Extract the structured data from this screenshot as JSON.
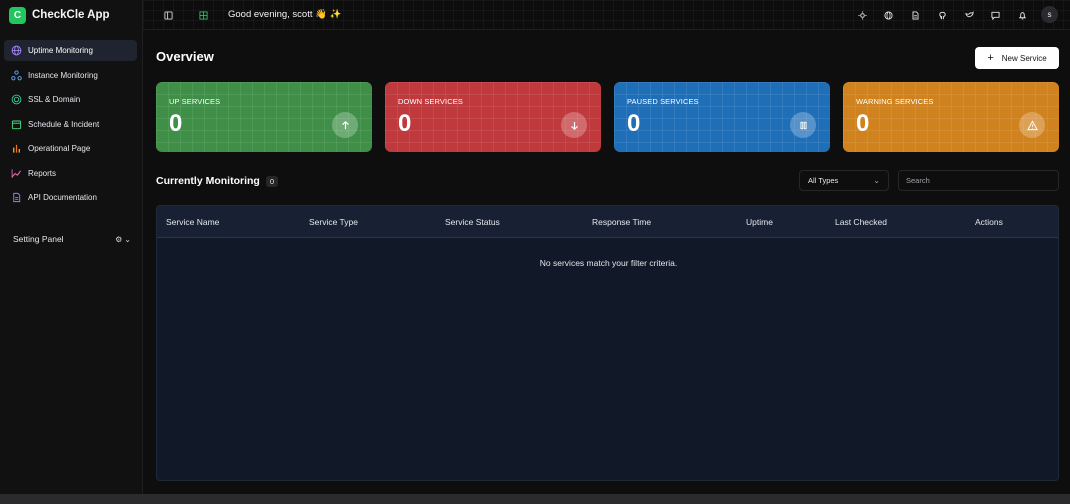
{
  "brand": {
    "logo_letter": "C",
    "name": "CheckCle App"
  },
  "sidebar": {
    "items": [
      {
        "label": "Uptime Monitoring",
        "icon": "globe-icon",
        "color": "#a78bfa",
        "active": true
      },
      {
        "label": "Instance Monitoring",
        "icon": "network-icon",
        "color": "#60a5fa"
      },
      {
        "label": "SSL & Domain",
        "icon": "shield-icon",
        "color": "#34d399"
      },
      {
        "label": "Schedule & Incident",
        "icon": "calendar-icon",
        "color": "#4ade80"
      },
      {
        "label": "Operational Page",
        "icon": "bar-chart-icon",
        "color": "#fbbf24"
      },
      {
        "label": "Reports",
        "icon": "line-chart-icon",
        "color": "#f472b6"
      },
      {
        "label": "API Documentation",
        "icon": "file-icon",
        "color": "#818cf8"
      }
    ],
    "setting_panel": "Setting Panel"
  },
  "topbar": {
    "greeting": "Good evening, scott 👋 ✨",
    "avatar_letter": "s",
    "icons": [
      "sidebar-toggle-icon",
      "grid-icon",
      "sun-icon",
      "globe-icon",
      "document-icon",
      "github-icon",
      "bird-icon",
      "message-icon",
      "bell-icon"
    ]
  },
  "overview": {
    "title": "Overview",
    "new_service_label": "New Service",
    "cards": [
      {
        "label": "UP SERVICES",
        "count": "0",
        "color": "#3f8f48",
        "icon": "arrow-up-icon"
      },
      {
        "label": "DOWN SERVICES",
        "count": "0",
        "color": "#c0393d",
        "icon": "arrow-down-icon"
      },
      {
        "label": "PAUSED SERVICES",
        "count": "0",
        "color": "#1f6fb8",
        "icon": "pause-icon"
      },
      {
        "label": "WARNING SERVICES",
        "count": "0",
        "color": "#d0821f",
        "icon": "warning-icon"
      }
    ]
  },
  "monitoring": {
    "title": "Currently Monitoring",
    "count": "0",
    "filter_selected": "All Types",
    "search_placeholder": "Search",
    "columns": [
      "Service Name",
      "Service Type",
      "Service Status",
      "Response Time",
      "Uptime",
      "Last Checked",
      "Actions"
    ],
    "empty_message": "No services match your filter criteria."
  }
}
